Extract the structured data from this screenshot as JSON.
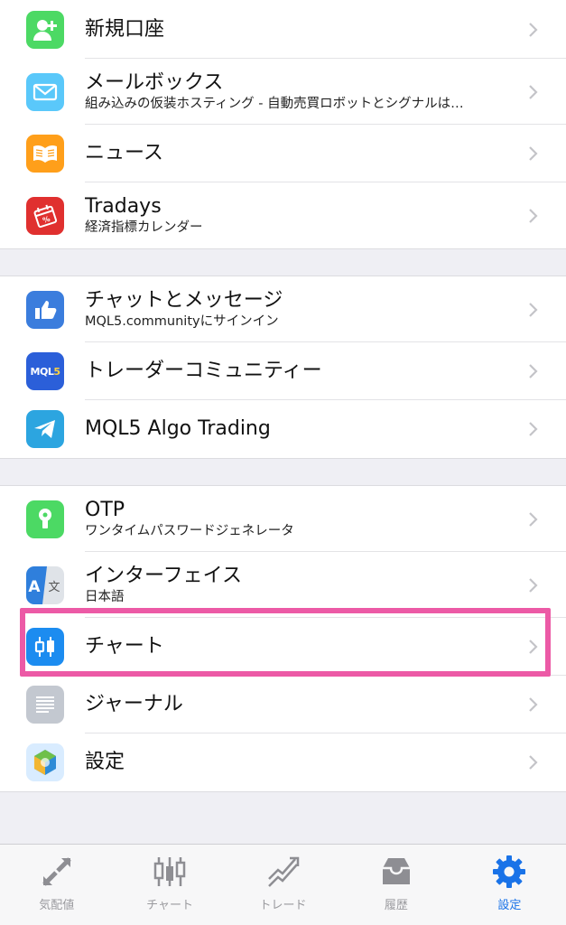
{
  "groups": [
    {
      "items": [
        {
          "title": "新規口座",
          "sub": "",
          "icon": "add-user-icon",
          "color": "#4cd964"
        },
        {
          "title": "メールボックス",
          "sub": "組み込みの仮装ホスティング - 自動売買ロボットとシグナルは…",
          "icon": "mail-icon",
          "color": "#5ac8fa"
        },
        {
          "title": "ニュース",
          "sub": "",
          "icon": "book-icon",
          "color": "#ff9f1a"
        },
        {
          "title": "Tradays",
          "sub": "経済指標カレンダー",
          "icon": "calendar-icon",
          "color": "#e0302f"
        }
      ]
    },
    {
      "items": [
        {
          "title": "チャットとメッセージ",
          "sub": "MQL5.communityにサインイン",
          "icon": "thumbs-up-icon",
          "color": "#3b7ddd"
        },
        {
          "title": "トレーダーコミュニティー",
          "sub": "",
          "icon": "mql5-logo-icon",
          "color": "#2b5fd9"
        },
        {
          "title": "MQL5 Algo Trading",
          "sub": "",
          "icon": "telegram-icon",
          "color": "#2ca5e0"
        }
      ]
    },
    {
      "items": [
        {
          "title": "OTP",
          "sub": "ワンタイムパスワードジェネレータ",
          "icon": "keyhole-icon",
          "color": "#4cd964"
        },
        {
          "title": "インターフェイス",
          "sub": "日本語",
          "icon": "translate-icon",
          "color": "#2f7fdc"
        },
        {
          "title": "チャート",
          "sub": "",
          "icon": "candlestick-icon",
          "color": "#1c8cf0"
        },
        {
          "title": "ジャーナル",
          "sub": "",
          "icon": "journal-icon",
          "color": "#c3c8d0"
        },
        {
          "title": "設定",
          "sub": "",
          "icon": "metatrader-icon",
          "color": "#6aa84f"
        }
      ]
    }
  ],
  "tabbar": {
    "tabs": [
      {
        "label": "気配値",
        "icon": "quotes-arrows-icon",
        "active": false
      },
      {
        "label": "チャート",
        "icon": "candlestick-tab-icon",
        "active": false
      },
      {
        "label": "トレード",
        "icon": "trade-trend-icon",
        "active": false
      },
      {
        "label": "履歴",
        "icon": "inbox-tray-icon",
        "active": false
      },
      {
        "label": "設定",
        "icon": "gear-icon",
        "active": true
      }
    ]
  },
  "colors": {
    "accent": "#1a73e8",
    "highlight": "#ec5aa6",
    "inactive_tab": "#9a9a9e"
  }
}
